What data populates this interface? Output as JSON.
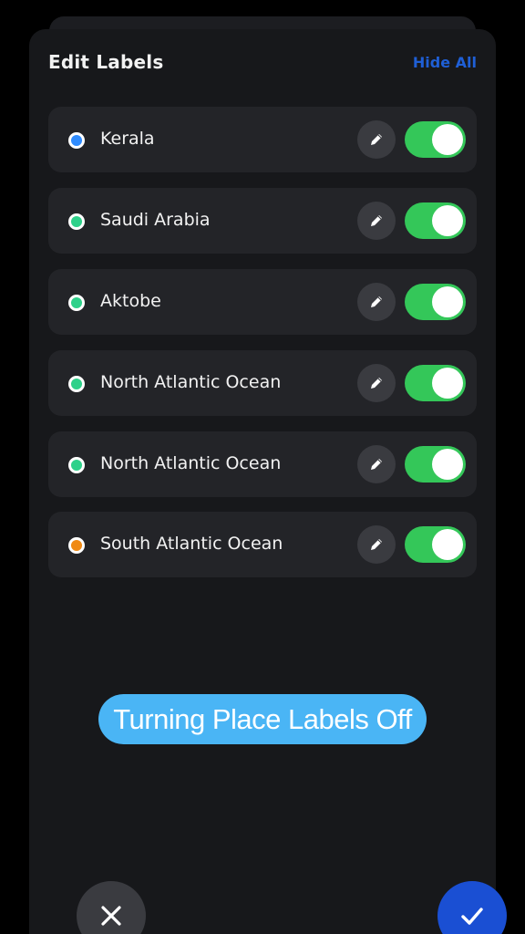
{
  "header": {
    "title": "Edit Labels",
    "hide_all_label": "Hide All"
  },
  "labels": [
    {
      "name": "Kerala",
      "dot_color": "#2f8cff",
      "enabled": true,
      "edit_icon": "pencil-icon"
    },
    {
      "name": "Saudi Arabia",
      "dot_color": "#2ed18a",
      "enabled": true,
      "edit_icon": "pencil-icon"
    },
    {
      "name": "Aktobe",
      "dot_color": "#2ed18a",
      "enabled": true,
      "edit_icon": "pencil-icon"
    },
    {
      "name": "North Atlantic Ocean",
      "dot_color": "#2ed18a",
      "enabled": true,
      "edit_icon": "pencil-icon"
    },
    {
      "name": "North Atlantic Ocean",
      "dot_color": "#2ed18a",
      "enabled": true,
      "edit_icon": "pencil-icon"
    },
    {
      "name": "South Atlantic Ocean",
      "dot_color": "#f08a14",
      "enabled": true,
      "edit_icon": "pencil-icon"
    }
  ],
  "caption": "Turning Place Labels Off",
  "footer": {
    "cancel_icon": "close-icon",
    "confirm_icon": "checkmark-icon"
  },
  "colors": {
    "toggle_on": "#34c759",
    "confirm": "#1a4fd3",
    "caption_bg": "#4ab5f5",
    "accent_link": "#1f5fd6"
  }
}
